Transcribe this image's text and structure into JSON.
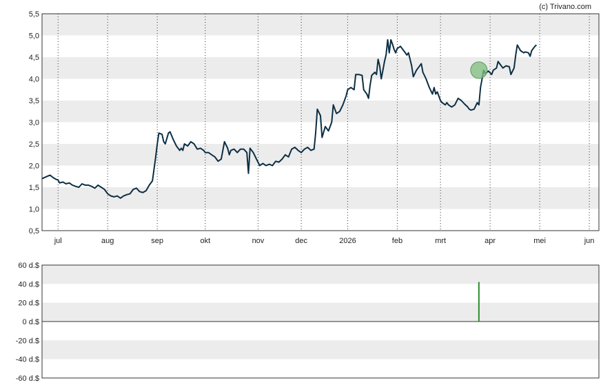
{
  "copyright": "(c) Trivano.com",
  "colors": {
    "price_line": "#0b2e44",
    "band": "#ececec",
    "marker_fill": "#7fbf7f",
    "marker_stroke": "#5a9a5a",
    "volume_bar": "#2e8b2e"
  },
  "chart_data": [
    {
      "type": "line",
      "name": "price",
      "ylim": [
        0.5,
        5.5
      ],
      "yticks": [
        "0,5",
        "1,0",
        "1,5",
        "2,0",
        "2,5",
        "3,0",
        "3,5",
        "4,0",
        "4,5",
        "5,0",
        "5,5"
      ],
      "x_tick_labels": [
        "jul",
        "aug",
        "sep",
        "okt",
        "nov",
        "dec",
        "2026",
        "feb",
        "mrt",
        "apr",
        "mei",
        "jun"
      ],
      "x_range_days": [
        0,
        348
      ],
      "x_tick_days": [
        10,
        41,
        72,
        102,
        135,
        162,
        191,
        222,
        249,
        280,
        311,
        342
      ],
      "grid": "vertical dotted",
      "points": [
        [
          0,
          1.7
        ],
        [
          3,
          1.75
        ],
        [
          5,
          1.78
        ],
        [
          7,
          1.72
        ],
        [
          9,
          1.68
        ],
        [
          10,
          1.67
        ],
        [
          11,
          1.6
        ],
        [
          13,
          1.62
        ],
        [
          15,
          1.58
        ],
        [
          17,
          1.6
        ],
        [
          19,
          1.55
        ],
        [
          21,
          1.52
        ],
        [
          23,
          1.5
        ],
        [
          25,
          1.58
        ],
        [
          27,
          1.55
        ],
        [
          29,
          1.55
        ],
        [
          31,
          1.52
        ],
        [
          33,
          1.48
        ],
        [
          35,
          1.55
        ],
        [
          37,
          1.5
        ],
        [
          39,
          1.45
        ],
        [
          41,
          1.35
        ],
        [
          43,
          1.3
        ],
        [
          45,
          1.28
        ],
        [
          47,
          1.3
        ],
        [
          49,
          1.25
        ],
        [
          51,
          1.3
        ],
        [
          53,
          1.33
        ],
        [
          55,
          1.35
        ],
        [
          57,
          1.45
        ],
        [
          59,
          1.48
        ],
        [
          61,
          1.4
        ],
        [
          63,
          1.38
        ],
        [
          65,
          1.42
        ],
        [
          67,
          1.55
        ],
        [
          69,
          1.65
        ],
        [
          71,
          2.2
        ],
        [
          72,
          2.5
        ],
        [
          73,
          2.75
        ],
        [
          75,
          2.72
        ],
        [
          76,
          2.55
        ],
        [
          77,
          2.5
        ],
        [
          79,
          2.75
        ],
        [
          80,
          2.78
        ],
        [
          82,
          2.6
        ],
        [
          84,
          2.45
        ],
        [
          85,
          2.4
        ],
        [
          86,
          2.35
        ],
        [
          87,
          2.4
        ],
        [
          88,
          2.35
        ],
        [
          89,
          2.5
        ],
        [
          91,
          2.45
        ],
        [
          93,
          2.55
        ],
        [
          95,
          2.5
        ],
        [
          97,
          2.38
        ],
        [
          99,
          2.4
        ],
        [
          101,
          2.35
        ],
        [
          102,
          2.3
        ],
        [
          104,
          2.3
        ],
        [
          106,
          2.25
        ],
        [
          108,
          2.2
        ],
        [
          110,
          2.1
        ],
        [
          112,
          2.15
        ],
        [
          114,
          2.55
        ],
        [
          116,
          2.4
        ],
        [
          117,
          2.25
        ],
        [
          118,
          2.35
        ],
        [
          120,
          2.38
        ],
        [
          122,
          2.3
        ],
        [
          124,
          2.38
        ],
        [
          126,
          2.38
        ],
        [
          128,
          2.3
        ],
        [
          129,
          1.82
        ],
        [
          130,
          2.4
        ],
        [
          132,
          2.3
        ],
        [
          134,
          2.15
        ],
        [
          136,
          2.0
        ],
        [
          138,
          2.05
        ],
        [
          140,
          2.0
        ],
        [
          142,
          2.03
        ],
        [
          144,
          2.0
        ],
        [
          146,
          2.1
        ],
        [
          148,
          2.08
        ],
        [
          150,
          2.15
        ],
        [
          152,
          2.25
        ],
        [
          154,
          2.2
        ],
        [
          156,
          2.38
        ],
        [
          158,
          2.42
        ],
        [
          160,
          2.35
        ],
        [
          162,
          2.3
        ],
        [
          164,
          2.38
        ],
        [
          166,
          2.42
        ],
        [
          168,
          2.35
        ],
        [
          170,
          2.38
        ],
        [
          171,
          2.75
        ],
        [
          172,
          3.3
        ],
        [
          174,
          3.15
        ],
        [
          175,
          2.65
        ],
        [
          177,
          2.9
        ],
        [
          179,
          2.8
        ],
        [
          181,
          3.0
        ],
        [
          182,
          3.4
        ],
        [
          184,
          3.2
        ],
        [
          186,
          3.25
        ],
        [
          188,
          3.4
        ],
        [
          190,
          3.6
        ],
        [
          191,
          3.75
        ],
        [
          193,
          3.8
        ],
        [
          195,
          3.75
        ],
        [
          196,
          4.1
        ],
        [
          198,
          4.1
        ],
        [
          200,
          4.08
        ],
        [
          201,
          3.75
        ],
        [
          203,
          3.65
        ],
        [
          204,
          3.55
        ],
        [
          205,
          3.85
        ],
        [
          206,
          4.08
        ],
        [
          208,
          4.15
        ],
        [
          209,
          4.1
        ],
        [
          210,
          4.45
        ],
        [
          211,
          4.3
        ],
        [
          212,
          4.0
        ],
        [
          213,
          4.2
        ],
        [
          214,
          4.4
        ],
        [
          215,
          4.55
        ],
        [
          216,
          4.9
        ],
        [
          217,
          4.6
        ],
        [
          218,
          4.9
        ],
        [
          219,
          4.8
        ],
        [
          220,
          4.68
        ],
        [
          221,
          4.6
        ],
        [
          222,
          4.7
        ],
        [
          224,
          4.75
        ],
        [
          226,
          4.65
        ],
        [
          228,
          4.55
        ],
        [
          229,
          4.6
        ],
        [
          230,
          4.45
        ],
        [
          231,
          4.3
        ],
        [
          232,
          4.05
        ],
        [
          234,
          4.2
        ],
        [
          235,
          4.25
        ],
        [
          237,
          4.35
        ],
        [
          238,
          4.15
        ],
        [
          240,
          4.0
        ],
        [
          242,
          3.8
        ],
        [
          244,
          3.65
        ],
        [
          245,
          3.8
        ],
        [
          246,
          3.65
        ],
        [
          247,
          3.7
        ],
        [
          248,
          3.6
        ],
        [
          249,
          3.5
        ],
        [
          250,
          3.45
        ],
        [
          252,
          3.4
        ],
        [
          253,
          3.45
        ],
        [
          254,
          3.4
        ],
        [
          256,
          3.35
        ],
        [
          258,
          3.4
        ],
        [
          260,
          3.55
        ],
        [
          262,
          3.5
        ],
        [
          264,
          3.42
        ],
        [
          266,
          3.35
        ],
        [
          267,
          3.3
        ],
        [
          268,
          3.28
        ],
        [
          270,
          3.3
        ],
        [
          272,
          3.45
        ],
        [
          273,
          3.4
        ],
        [
          274,
          3.8
        ],
        [
          275,
          4.0
        ],
        [
          276,
          4.2
        ],
        [
          277,
          4.12
        ],
        [
          279,
          4.18
        ],
        [
          281,
          4.1
        ],
        [
          282,
          4.2
        ],
        [
          284,
          4.25
        ],
        [
          285,
          4.4
        ],
        [
          286,
          4.35
        ],
        [
          288,
          4.25
        ],
        [
          290,
          4.3
        ],
        [
          292,
          4.28
        ],
        [
          293,
          4.1
        ],
        [
          295,
          4.25
        ],
        [
          296,
          4.55
        ],
        [
          297,
          4.78
        ],
        [
          299,
          4.65
        ],
        [
          301,
          4.6
        ],
        [
          302,
          4.62
        ],
        [
          304,
          4.6
        ],
        [
          305,
          4.52
        ],
        [
          306,
          4.65
        ],
        [
          308,
          4.75
        ],
        [
          309,
          4.78
        ]
      ],
      "annotation": {
        "type": "marker",
        "x_day": 273,
        "y": 4.2
      }
    },
    {
      "type": "bar",
      "name": "volume",
      "ylim": [
        -60,
        60
      ],
      "yticks": [
        "60 d.$",
        "40 d.$",
        "20 d.$",
        "0 d.$",
        "-20 d.$",
        "-40 d.$",
        "-60 d.$"
      ],
      "bars": [
        {
          "x_day": 273,
          "value": 42
        }
      ]
    }
  ]
}
